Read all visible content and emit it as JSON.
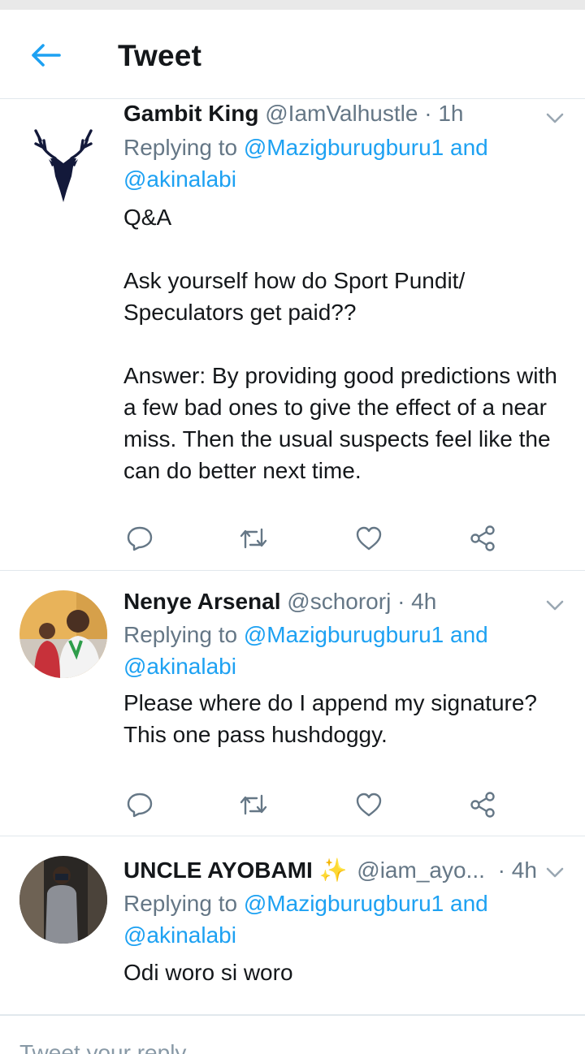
{
  "header": {
    "title": "Tweet",
    "back_icon": "arrow-left-icon",
    "accent": "#1da1f2"
  },
  "tweets": [
    {
      "name": "Gambit King",
      "handle": "@IamValhustle",
      "time": "· 1h",
      "replying_prefix": "Replying to ",
      "mention_1": "@Mazigburugburu1",
      "and": " and",
      "mention_2": "@akinalabi",
      "text": "Q&A\n\nAsk yourself how do Sport Pundit/ Speculators get paid??\n\nAnswer: By providing good predictions with a few bad ones to give the effect of a near miss. Then the usual suspects feel like the can do better next time."
    },
    {
      "name": "Nenye Arsenal",
      "handle": "@schororj",
      "time": "· 4h",
      "replying_prefix": "Replying to ",
      "mention_1": "@Mazigburugburu1",
      "and": " and",
      "mention_2": "@akinalabi",
      "text": "Please where do I append my signature? This one pass hushdoggy."
    },
    {
      "name": "UNCLE AYOBAMI",
      "sparkle": "✨",
      "handle": "@iam_ayo...",
      "time": "· 4h",
      "replying_prefix": "Replying to ",
      "mention_1": "@Mazigburugburu1",
      "and": " and",
      "mention_2": "@akinalabi",
      "text": "Odi woro si woro"
    }
  ],
  "actions": [
    "reply-icon",
    "retweet-icon",
    "like-icon",
    "share-icon"
  ],
  "reply_bar": {
    "placeholder": "Tweet your reply"
  }
}
